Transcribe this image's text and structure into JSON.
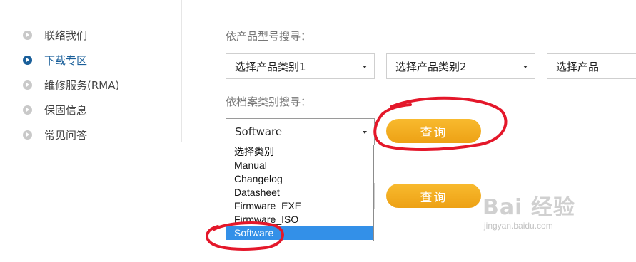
{
  "sidebar": {
    "items": [
      {
        "label": "联络我们",
        "active": false
      },
      {
        "label": "下载专区",
        "active": true
      },
      {
        "label": "维修服务(RMA)",
        "active": false
      },
      {
        "label": "保固信息",
        "active": false
      },
      {
        "label": "常见问答",
        "active": false
      }
    ]
  },
  "product_search": {
    "label": "依产品型号搜寻：",
    "selects": [
      {
        "value": "选择产品类别1"
      },
      {
        "value": "选择产品类别2"
      },
      {
        "value": "选择产品"
      }
    ]
  },
  "doc_search": {
    "label": "依档案类别搜寻：",
    "select_value": "Software",
    "query_button": "查询",
    "options": [
      "选择类别",
      "Manual",
      "Changelog",
      "Datasheet",
      "Firmware_EXE",
      "Firmware_ISO",
      "Software"
    ],
    "selected_option": "Software"
  },
  "second_query_button": "查询",
  "watermark": {
    "logo": "Bai 经验",
    "url": "jingyan.baidu.com"
  },
  "colors": {
    "accent_blue": "#1a5f9a",
    "button_orange": "#f2a91f",
    "highlight_blue": "#3390e8",
    "annotation_red": "#e4172a"
  }
}
